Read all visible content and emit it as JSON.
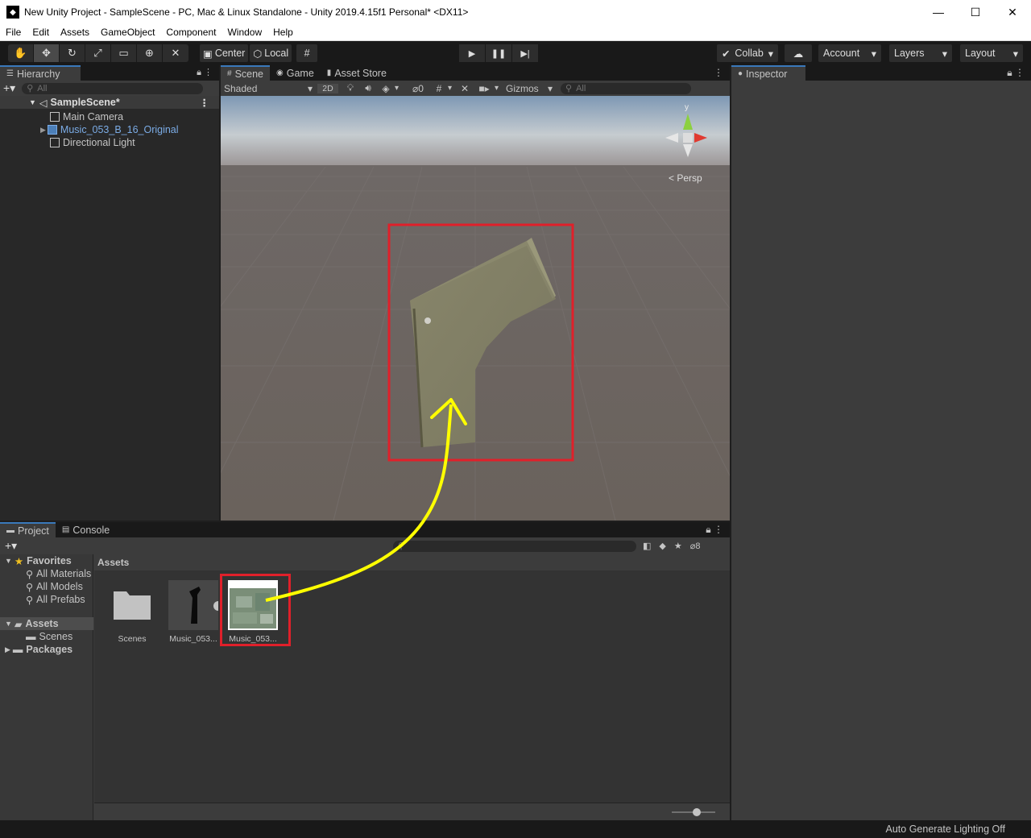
{
  "window": {
    "title": "New Unity Project - SampleScene - PC, Mac & Linux Standalone - Unity 2019.4.15f1 Personal* <DX11>",
    "minimize": "—",
    "maximize": "☐",
    "close": "✕"
  },
  "menu": [
    "File",
    "Edit",
    "Assets",
    "GameObject",
    "Component",
    "Window",
    "Help"
  ],
  "toolbar": {
    "pivot_center": "Center",
    "pivot_local": "Local",
    "collab": "Collab",
    "account": "Account",
    "layers": "Layers",
    "layout": "Layout"
  },
  "hierarchy": {
    "tab": "Hierarchy",
    "search_placeholder": "All",
    "scene": "SampleScene*",
    "items": [
      "Main Camera",
      "Music_053_B_16_Original",
      "Directional Light"
    ]
  },
  "scene": {
    "tabs": [
      "Scene",
      "Game",
      "Asset Store"
    ],
    "shading": "Shaded",
    "mode2d": "2D",
    "hidden_count": "0",
    "gizmos": "Gizmos",
    "search_placeholder": "All",
    "persp": "Persp",
    "gizmo_y": "y"
  },
  "inspector": {
    "tab": "Inspector"
  },
  "project": {
    "tabs": [
      "Project",
      "Console"
    ],
    "hidden_count": "8",
    "favorites_label": "Favorites",
    "favorites": [
      "All Materials",
      "All Models",
      "All Prefabs"
    ],
    "assets_label": "Assets",
    "assets_children": [
      "Scenes"
    ],
    "packages_label": "Packages",
    "breadcrumb": "Assets",
    "items": [
      "Scenes",
      "Music_053...",
      "Music_053..."
    ]
  },
  "status": {
    "lighting": "Auto Generate Lighting Off"
  },
  "colors": {
    "highlight_box": "#e0202a",
    "arrow": "#ffff00",
    "selection_blue": "#3a79bb",
    "prefab_blue": "#7bace6"
  }
}
